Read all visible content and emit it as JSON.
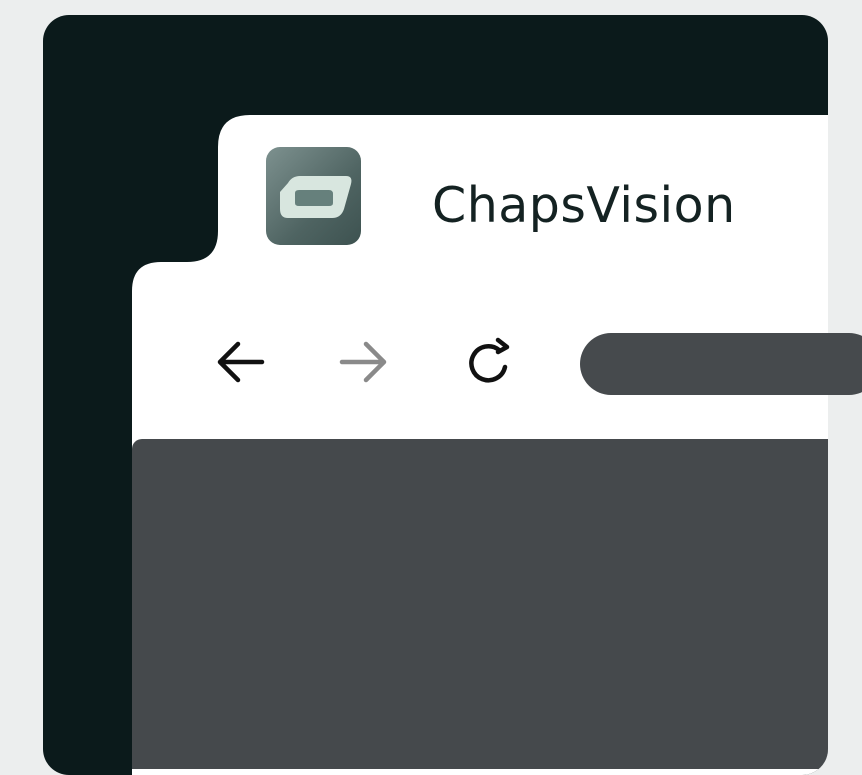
{
  "tab": {
    "title": "ChapsVision",
    "icon": "chapsvision-logo-icon"
  },
  "toolbar": {
    "back_icon": "arrow-left-icon",
    "forward_icon": "arrow-right-icon",
    "reload_icon": "reload-icon"
  },
  "colors": {
    "page_background": "#eceeee",
    "frame": "#0b1a1b",
    "window": "#ffffff",
    "content": "#45494c",
    "address_bar": "#464a4d",
    "logo": "#5b706e"
  }
}
